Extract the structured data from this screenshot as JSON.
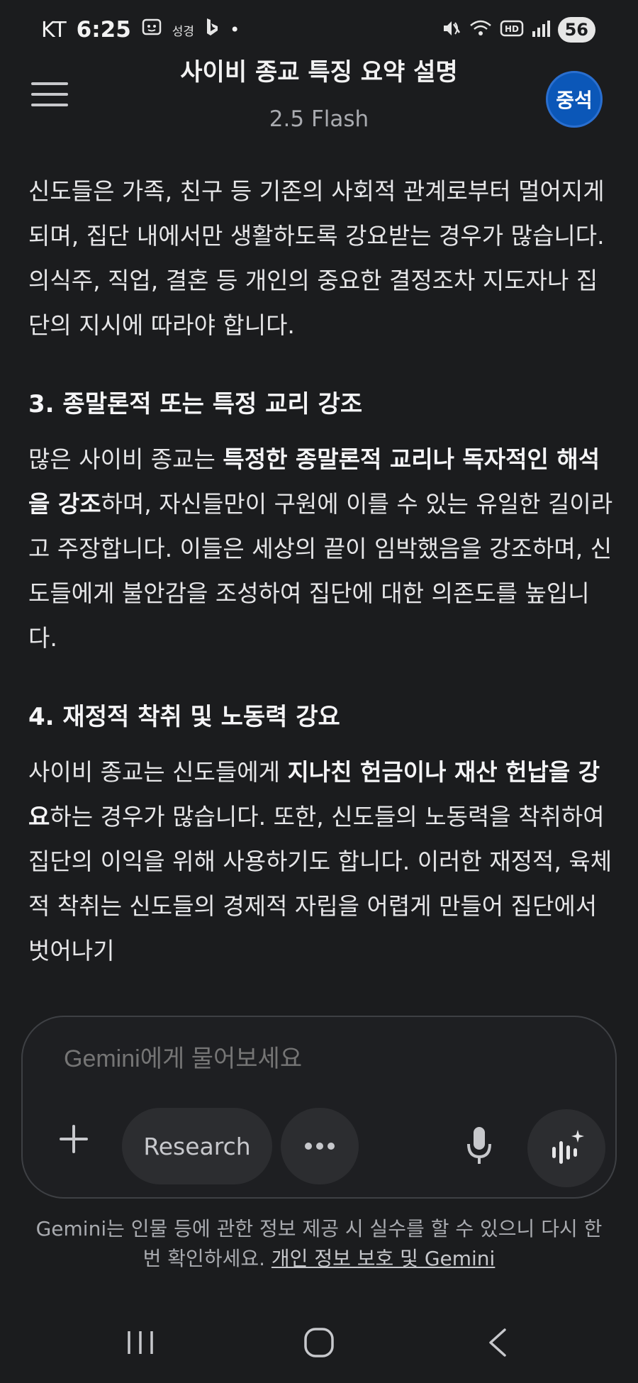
{
  "status_bar": {
    "carrier": "KT",
    "time": "6:25",
    "notif_text": "성경",
    "dot": "•",
    "battery": "56",
    "icons": [
      "screenshot-icon",
      "bing-icon",
      "mute-icon",
      "wifi-icon",
      "hd-icon",
      "signal-icon"
    ]
  },
  "header": {
    "title": "사이비 종교 특징 요약 설명",
    "model": "2.5 Flash",
    "avatar_text": "중석"
  },
  "content": {
    "para1": "신도들은 가족, 친구 등 기존의 사회적 관계로부터 멀어지게 되며, 집단 내에서만 생활하도록 강요받는 경우가 많습니다. 의식주, 직업, 결혼 등 개인의 중요한 결정조차 지도자나 집단의 지시에 따라야 합니다.",
    "heading3": "3. 종말론적 또는 특정 교리 강조",
    "para3_a": "많은 사이비 종교는 ",
    "para3_b": "특정한 종말론적 교리나 독자적인 해석을 강조",
    "para3_c": "하며, 자신들만이 구원에 이를 수 있는 유일한 길이라고 주장합니다. 이들은 세상의 끝이 임박했음을 강조하며, 신도들에게 불안감을 조성하여 집단에 대한 의존도를 높입니다.",
    "heading4": "4. 재정적 착취 및 노동력 강요",
    "para4_a": "사이비 종교는 신도들에게 ",
    "para4_b": "지나친 헌금이나 재산 헌납을 강요",
    "para4_c": "하는 경우가 많습니다. 또한, 신도들의 노동력을 착취하여 집단의 이익을 위해 사용하기도 합니다. 이러한 재정적, 육체적 착취는 신도들의 경제적 자립을 어렵게 만들어 집단에서 벗어나기"
  },
  "input": {
    "placeholder": "Gemini에게 물어보세요",
    "research_label": "Research"
  },
  "disclaimer": {
    "text": "Gemini는 인물 등에 관한 정보 제공 시 실수를 할 수 있으니 다시 한번 확인하세요. ",
    "link": "개인 정보 보호 및 Gemini"
  },
  "colors": {
    "background": "#1b1c1e",
    "avatar": "#0b57b8",
    "text": "#e6e6e8",
    "muted": "#a9abb0"
  }
}
